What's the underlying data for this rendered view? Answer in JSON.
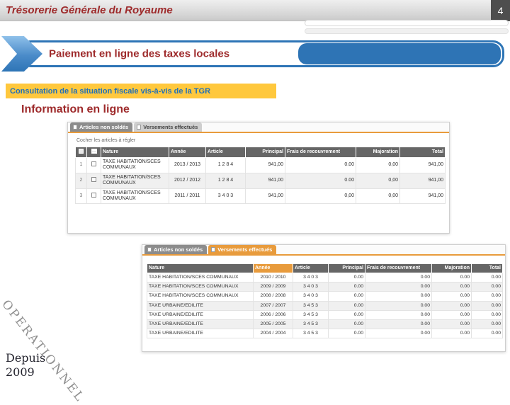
{
  "colors": {
    "maroon": "#9E2A2B",
    "blue": "#2E75B6",
    "yellow": "#FFC83D",
    "orange": "#E89B3C",
    "table_header_gray": "#666666"
  },
  "header": {
    "title": "Trésorerie Générale du Royaume",
    "page_number": "4"
  },
  "banner": {
    "title": "Paiement en ligne des taxes locales"
  },
  "highlight": {
    "text": "Consultation de la situation fiscale vis-à-vis de la TGR"
  },
  "section_title": "Information en ligne",
  "screenshot1": {
    "tabs": [
      {
        "label": "Articles non soldés"
      },
      {
        "label": "Versements effectués"
      }
    ],
    "instruction": "Cocher les articles à régler",
    "columns": [
      "Nature",
      "Année",
      "Article",
      "Principal",
      "Frais de recouvrement",
      "Majoration",
      "Total"
    ],
    "rows": [
      {
        "num": "1",
        "nature": "TAXE HABITATION/SCES COMMUNAUX",
        "annee": "2013 / 2013",
        "article": "1 2 8 4",
        "principal": "941,00",
        "frais": "0.00",
        "majoration": "0,00",
        "total": "941,00"
      },
      {
        "num": "2",
        "nature": "TAXE HABITATION/SCES COMMUNAUX",
        "annee": "2012 / 2012",
        "article": "1 2 8 4",
        "principal": "941,00",
        "frais": "0.00",
        "majoration": "0,00",
        "total": "941,00"
      },
      {
        "num": "3",
        "nature": "TAXE HABITATION/SCES COMMUNAUX",
        "annee": "2011 / 2011",
        "article": "3 4 0 3",
        "principal": "941,00",
        "frais": "0,00",
        "majoration": "0,00",
        "total": "941,00"
      }
    ]
  },
  "screenshot2": {
    "tabs": [
      {
        "label": "Articles non soldés"
      },
      {
        "label": "Versements effectués"
      }
    ],
    "columns": [
      "Nature",
      "Année",
      "Article",
      "Principal",
      "Frais de recouvrement",
      "Majoration",
      "Total"
    ],
    "rows": [
      {
        "nature": "TAXE HABITATION/SCES COMMUNAUX",
        "annee": "2010 / 2010",
        "article": "3 4 0 3",
        "principal": "0.00",
        "frais": "0.00",
        "majoration": "0.00",
        "total": "0.00"
      },
      {
        "nature": "TAXE HABITATION/SCES COMMUNAUX",
        "annee": "2009 / 2009",
        "article": "3 4 0 3",
        "principal": "0.00",
        "frais": "0.00",
        "majoration": "0.00",
        "total": "0.00"
      },
      {
        "nature": "TAXE HABITATION/SCES COMMUNAUX",
        "annee": "2008 / 2008",
        "article": "3 4 0 3",
        "principal": "0.00",
        "frais": "0.00",
        "majoration": "0.00",
        "total": "0.00"
      },
      {
        "nature": "TAXE URBAINE/EDILITE",
        "annee": "2007 / 2007",
        "article": "3 4 5 3",
        "principal": "0.00",
        "frais": "0.00",
        "majoration": "0.00",
        "total": "0.00"
      },
      {
        "nature": "TAXE URBAINE/EDILITE",
        "annee": "2006 / 2006",
        "article": "3 4 5 3",
        "principal": "0.00",
        "frais": "0.00",
        "majoration": "0.00",
        "total": "0.00"
      },
      {
        "nature": "TAXE URBAINE/EDILITE",
        "annee": "2005 / 2005",
        "article": "3 4 5 3",
        "principal": "0.00",
        "frais": "0.00",
        "majoration": "0.00",
        "total": "0.00"
      },
      {
        "nature": "TAXE URBAINE/EDILITE",
        "annee": "2004 / 2004",
        "article": "3 4 5 3",
        "principal": "0.00",
        "frais": "0.00",
        "majoration": "0.00",
        "total": "0.00"
      }
    ]
  },
  "watermark": {
    "rotated": "OPERATIONNEL",
    "caption_line1": "Depuis",
    "caption_line2": "2009"
  }
}
